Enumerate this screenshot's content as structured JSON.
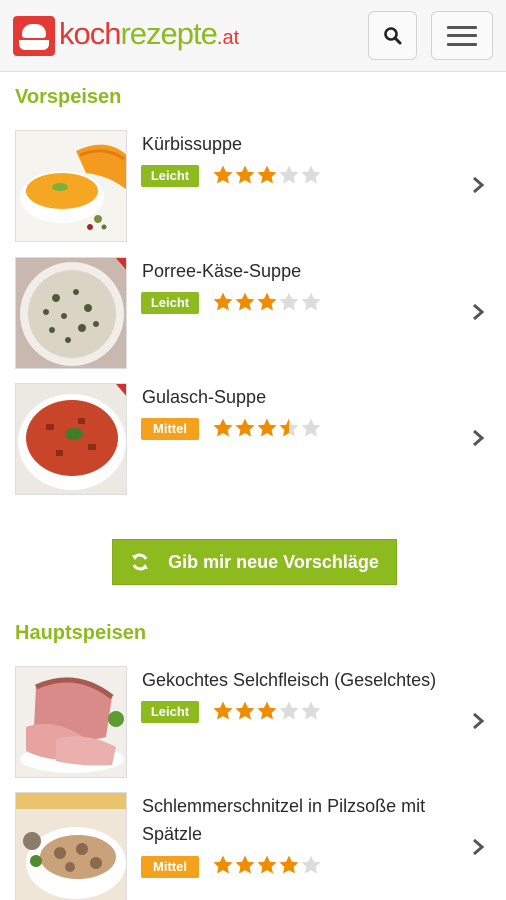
{
  "header": {
    "logo": {
      "koch": "koch",
      "rezepte": "rezepte",
      "tld": ".at"
    },
    "icons": [
      "search-icon",
      "menu-icon"
    ]
  },
  "colors": {
    "green": "#8dbb1f",
    "orange": "#f4a11d",
    "red": "#e53935",
    "star": "#f08c00",
    "star_empty": "#dcdcdc"
  },
  "sections": [
    {
      "title": "Vorspeisen",
      "recipes": [
        {
          "name": "Kürbissuppe",
          "difficulty": "Leicht",
          "rating": 3
        },
        {
          "name": "Porree-Käse-Suppe",
          "difficulty": "Leicht",
          "rating": 3
        },
        {
          "name": "Gulasch-Suppe",
          "difficulty": "Mittel",
          "rating": 3.5
        }
      ]
    },
    {
      "title": "Hauptspeisen",
      "recipes": [
        {
          "name": "Gekochtes Selchfleisch (Geselchtes)",
          "difficulty": "Leicht",
          "rating": 3
        },
        {
          "name": "Schlemmerschnitzel in Pilzsoße mit Spätzle",
          "difficulty": "Mittel",
          "rating": 4
        }
      ]
    }
  ],
  "suggest_button": {
    "label": "Gib mir neue Vorschläge",
    "icon": "refresh-icon"
  },
  "rating_max": 5
}
